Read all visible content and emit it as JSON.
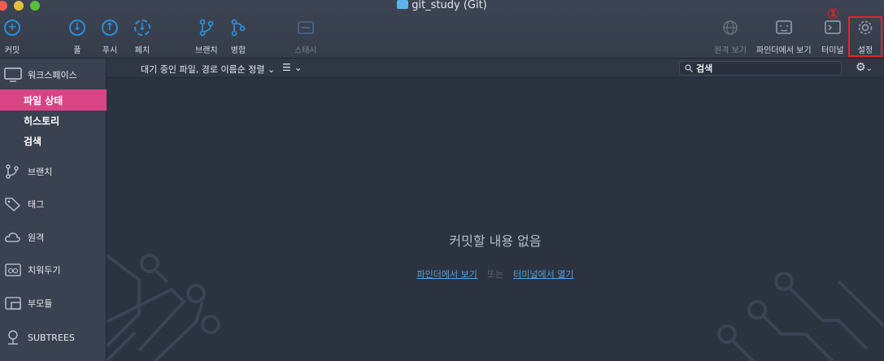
{
  "window": {
    "title": "git_study (Git)"
  },
  "toolbar": {
    "commit": "커밋",
    "pull": "풀",
    "push": "푸시",
    "fetch": "페치",
    "branch": "브랜치",
    "merge": "병합",
    "stash": "스태시",
    "show_remote": "원격 보기",
    "show_in_finder": "파인더에서 보기",
    "terminal": "터미널",
    "settings": "설정",
    "annotation_number": "①"
  },
  "sidebar": {
    "workspace": "워크스페이스",
    "file_status": "파일 상태",
    "history": "히스토리",
    "search": "검색",
    "branches": "브랜치",
    "tags": "태그",
    "remotes": "원격",
    "stashes": "치워두기",
    "submodules": "부모듈",
    "subtrees": "SUBTREES"
  },
  "subbar": {
    "sort_label": "대기 중인 파일, 경로 이름순 정렬 ⌄",
    "view_label": "☰ ⌄",
    "search_value": "검색"
  },
  "main": {
    "empty_message": "커밋할 내용 없음",
    "finder_link": "파인더에서 보기",
    "or": "또는",
    "terminal_link": "터미널에서 열기"
  },
  "colors": {
    "accent": "#d94485",
    "highlight": "#e52424",
    "link": "#4ea3e6"
  }
}
